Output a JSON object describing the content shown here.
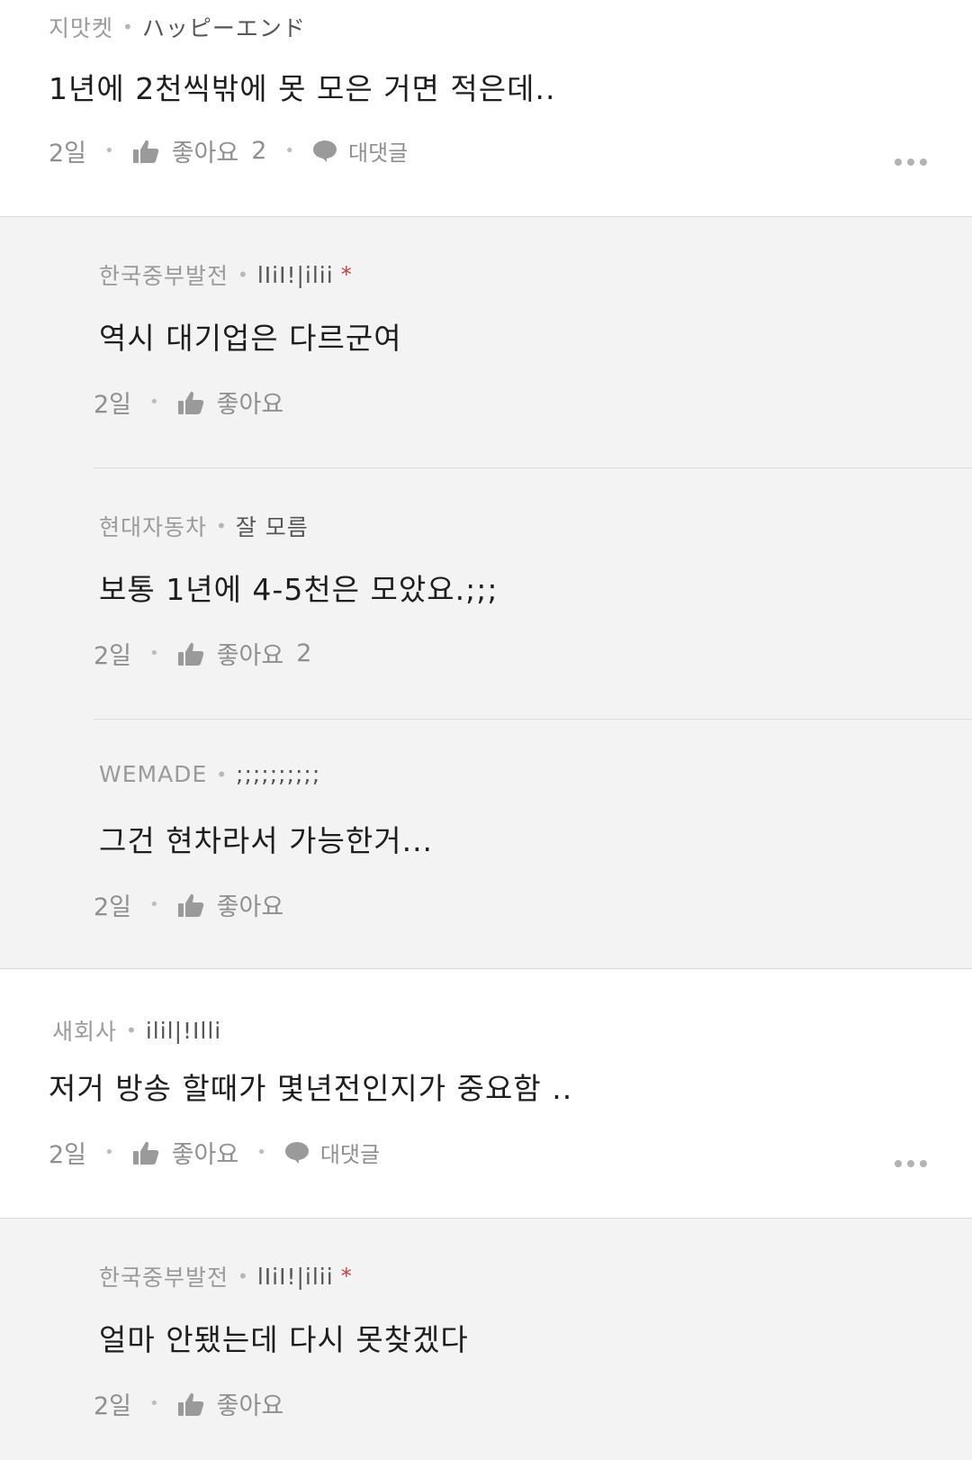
{
  "comments": [
    {
      "company": "지맛켓",
      "nickname": "ハッピーエンド",
      "text": "1년에 2천씩밖에 못 모은 거면 적은데..",
      "time": "2일",
      "like_label": "좋아요",
      "like_count": "2",
      "reply_label": "대댓글",
      "replies": [
        {
          "company": "한국중부발전",
          "nickname": "lIiI!|ilii",
          "badge": "*",
          "text": "역시 대기업은 다르군여",
          "time": "2일",
          "like_label": "좋아요",
          "like_count": ""
        },
        {
          "company": "현대자동차",
          "nickname": "잘 모름",
          "badge": "",
          "text": "보통 1년에 4-5천은 모았요.;;;",
          "time": "2일",
          "like_label": "좋아요",
          "like_count": "2"
        },
        {
          "company": "WEMADE",
          "nickname": ";;;;;;;;;;",
          "badge": "",
          "text": "그건 현차라서 가능한거...",
          "time": "2일",
          "like_label": "좋아요",
          "like_count": ""
        }
      ]
    },
    {
      "company": "새회사",
      "nickname": "ilil|!Illi",
      "text": "저거 방송 할때가 몇년전인지가 중요함 ..",
      "time": "2일",
      "like_label": "좋아요",
      "like_count": "",
      "reply_label": "대댓글",
      "replies": [
        {
          "company": "한국중부발전",
          "nickname": "lIiI!|ilii",
          "badge": "*",
          "text": "얼마 안됐는데 다시 못찾겠다",
          "time": "2일",
          "like_label": "좋아요",
          "like_count": ""
        }
      ]
    }
  ],
  "colors": {
    "reply_background": "#f3f3f3",
    "badge_red": "#d23b3b",
    "meta_gray": "#8a8a8a"
  },
  "icons": {
    "like": "thumbs-up-icon",
    "reply": "speech-bubble-icon",
    "more": "more-dots-icon"
  }
}
